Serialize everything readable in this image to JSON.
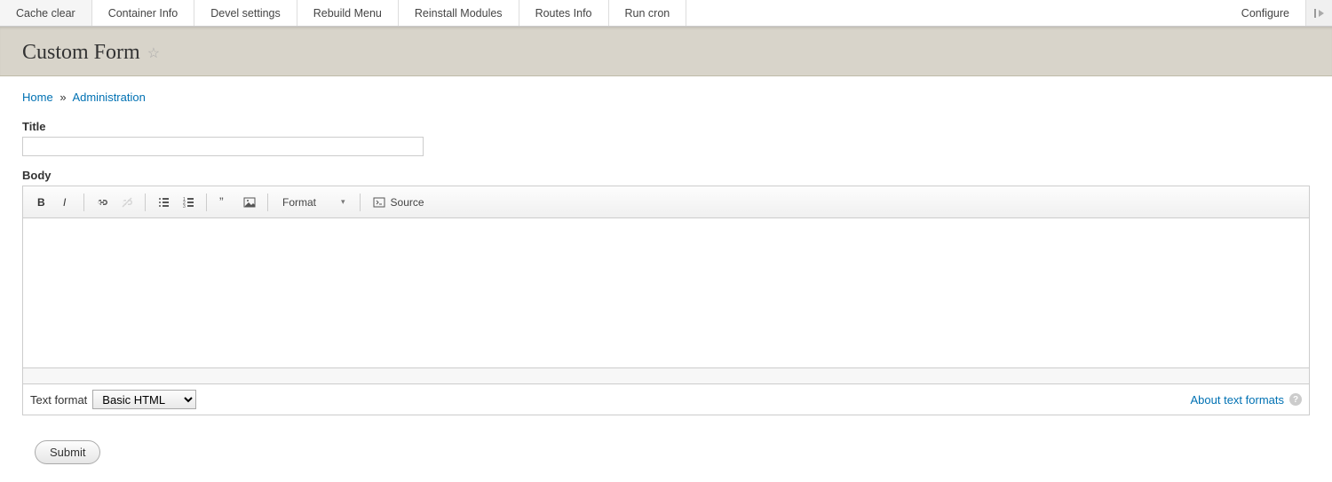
{
  "toolbar": {
    "items": [
      "Cache clear",
      "Container Info",
      "Devel settings",
      "Rebuild Menu",
      "Reinstall Modules",
      "Routes Info",
      "Run cron"
    ],
    "configure": "Configure"
  },
  "page": {
    "title": "Custom Form"
  },
  "breadcrumb": {
    "home": "Home",
    "sep": "»",
    "admin": "Administration"
  },
  "form": {
    "title_label": "Title",
    "title_value": "",
    "body_label": "Body",
    "format_button": "Format",
    "source_button": "Source",
    "text_format_label": "Text format",
    "text_format_selected": "Basic HTML",
    "text_format_options": [
      "Basic HTML"
    ],
    "about_link": "About text formats",
    "submit": "Submit"
  }
}
